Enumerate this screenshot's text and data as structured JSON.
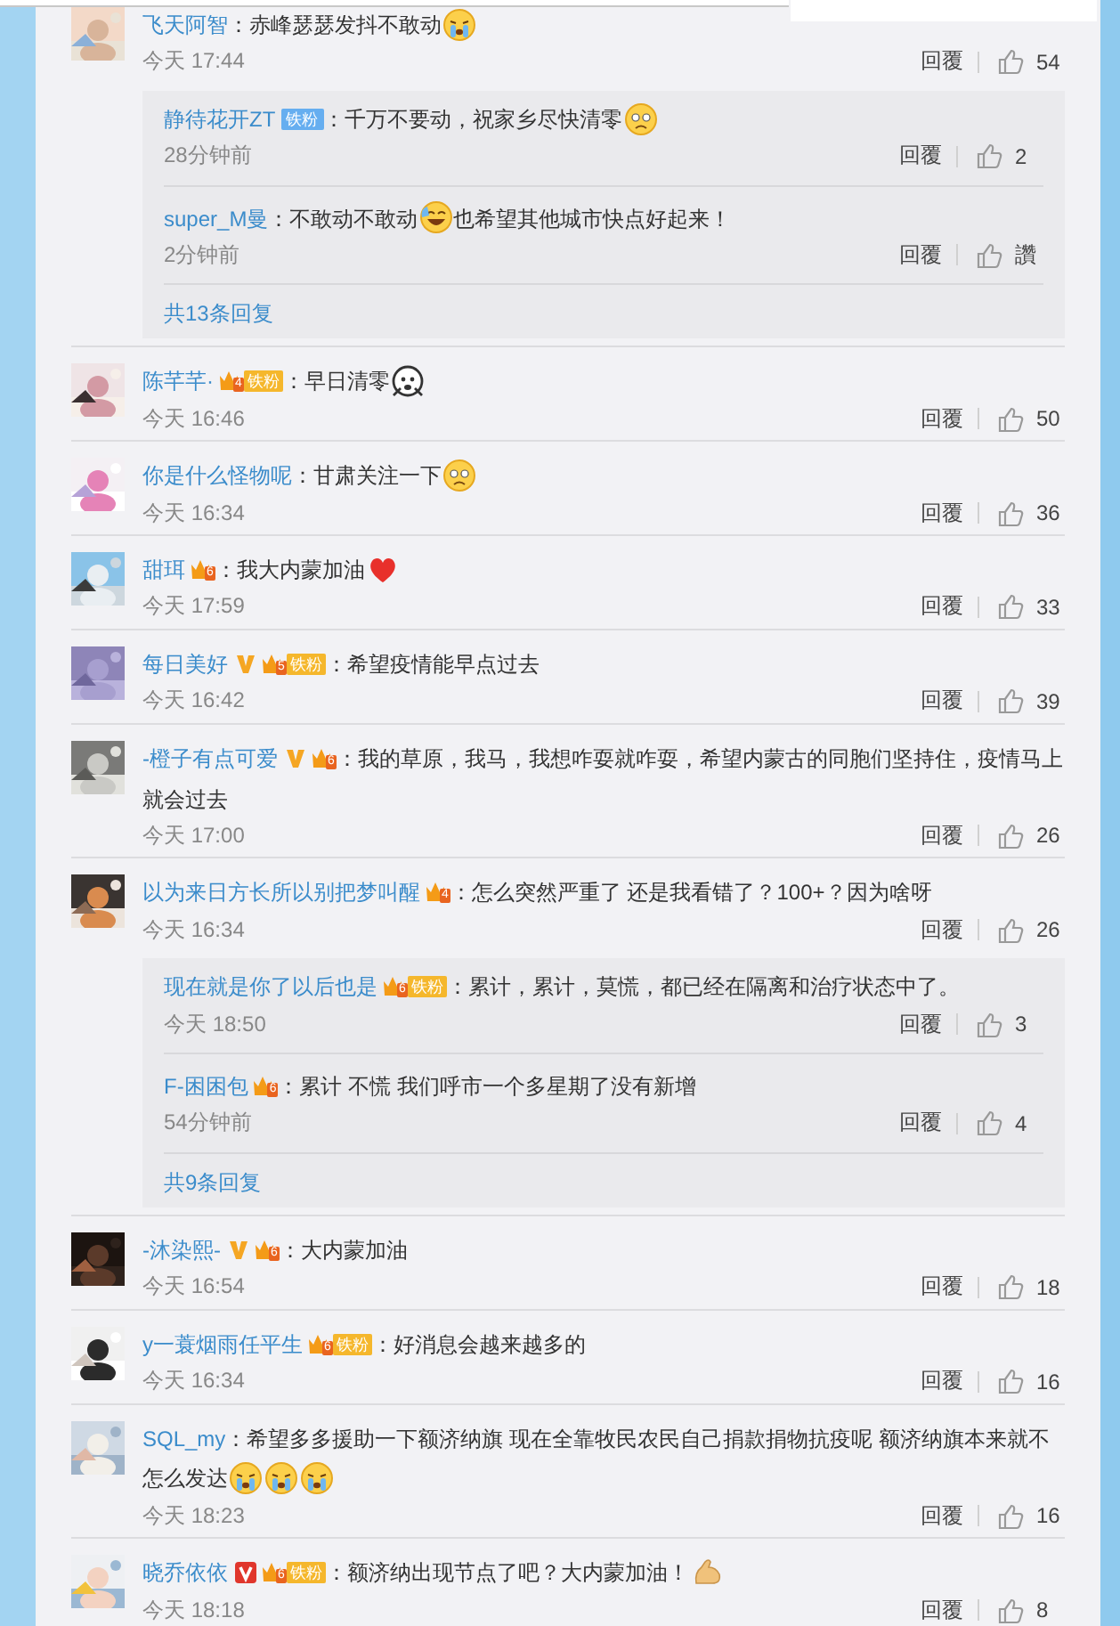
{
  "comments": [
    {
      "name": "飞天阿智",
      "lines": [
        [
          {
            "kind": "text",
            "text": "：赤峰瑟瑟发抖不敢动"
          },
          {
            "kind": "crying"
          }
        ]
      ],
      "time": "今天 17:44",
      "reply_label": "回覆",
      "likes": "54",
      "replies": [
        {
          "name": "静待花开ZT",
          "badges": [
            {
              "kind": "fan-blue",
              "text": "铁粉"
            }
          ],
          "lines": [
            [
              {
                "kind": "text",
                "text": "：千万不要动，祝家乡尽快清零"
              },
              {
                "kind": "sad"
              }
            ]
          ],
          "time": "28分钟前",
          "reply_label": "回覆",
          "likes": "2"
        },
        {
          "name": "super_M曼",
          "lines": [
            [
              {
                "kind": "text",
                "text": "：不敢动不敢动"
              },
              {
                "kind": "laughing"
              },
              {
                "kind": "text",
                "text": "也希望其他城市快点好起来！"
              }
            ]
          ],
          "time": "2分钟前",
          "reply_label": "回覆",
          "likes": "讚"
        }
      ],
      "more": "共13条回复"
    },
    {
      "name": "陈芊芊·",
      "badges": [
        {
          "kind": "crown",
          "text": "4"
        },
        {
          "kind": "fan",
          "text": "铁粉"
        }
      ],
      "lines": [
        [
          {
            "kind": "text",
            "text": "：早日清零"
          },
          {
            "kind": "scared"
          }
        ]
      ],
      "time": "今天 16:46",
      "reply_label": "回覆",
      "likes": "50"
    },
    {
      "name": "你是什么怪物呢",
      "lines": [
        [
          {
            "kind": "text",
            "text": "：甘肃关注一下"
          },
          {
            "kind": "sad"
          }
        ]
      ],
      "time": "今天 16:34",
      "reply_label": "回覆",
      "likes": "36"
    },
    {
      "name": "甜珥",
      "badges": [
        {
          "kind": "crown",
          "text": "6"
        }
      ],
      "lines": [
        [
          {
            "kind": "text",
            "text": "：我大内蒙加油"
          },
          {
            "kind": "heart"
          }
        ]
      ],
      "time": "今天 17:59",
      "reply_label": "回覆",
      "likes": "33"
    },
    {
      "name": "每日美好",
      "badges": [
        {
          "kind": "verified",
          "color": "#f5a623"
        },
        {
          "kind": "crown",
          "text": "5"
        },
        {
          "kind": "fan",
          "text": "铁粉"
        }
      ],
      "lines": [
        [
          {
            "kind": "text",
            "text": "：希望疫情能早点过去"
          }
        ]
      ],
      "time": "今天 16:42",
      "reply_label": "回覆",
      "likes": "39"
    },
    {
      "name": "-橙子有点可爱",
      "badges": [
        {
          "kind": "verified",
          "color": "#f5a623"
        },
        {
          "kind": "crown",
          "text": "6"
        }
      ],
      "lines": [
        [
          {
            "kind": "text",
            "text": "：我的草原，我马，我想咋耍就咋耍，希望内蒙古的同胞们坚持住，疫情马上"
          }
        ],
        [
          {
            "kind": "text",
            "text": "就会过去"
          }
        ]
      ],
      "time": "今天 17:00",
      "reply_label": "回覆",
      "likes": "26"
    },
    {
      "name": "以为来日方长所以别把梦叫醒",
      "badges": [
        {
          "kind": "crown",
          "text": "4"
        }
      ],
      "lines": [
        [
          {
            "kind": "text",
            "text": "：怎么突然严重了 还是我看错了？100+？因为啥呀"
          }
        ]
      ],
      "time": "今天 16:34",
      "reply_label": "回覆",
      "likes": "26",
      "replies": [
        {
          "name": "现在就是你了以后也是",
          "badges": [
            {
              "kind": "crown",
              "text": "6"
            },
            {
              "kind": "fan",
              "text": "铁粉"
            }
          ],
          "lines": [
            [
              {
                "kind": "text",
                "text": "：累计，累计，莫慌，都已经在隔离和治疗状态中了。"
              }
            ]
          ],
          "time": "今天 18:50",
          "reply_label": "回覆",
          "likes": "3"
        },
        {
          "name": "F-困困包",
          "badges": [
            {
              "kind": "crown",
              "text": "6"
            }
          ],
          "lines": [
            [
              {
                "kind": "text",
                "text": "：累计 不慌 我们呼市一个多星期了没有新增"
              }
            ]
          ],
          "time": "54分钟前",
          "reply_label": "回覆",
          "likes": "4"
        }
      ],
      "more": "共9条回复"
    },
    {
      "name": "-沐染熙-",
      "badges": [
        {
          "kind": "verified",
          "color": "#f5a623"
        },
        {
          "kind": "crown",
          "text": "6"
        }
      ],
      "lines": [
        [
          {
            "kind": "text",
            "text": "：大内蒙加油"
          }
        ]
      ],
      "time": "今天 16:54",
      "reply_label": "回覆",
      "likes": "18"
    },
    {
      "name": "y一蓑烟雨任平生",
      "badges": [
        {
          "kind": "crown",
          "text": "6"
        },
        {
          "kind": "fan",
          "text": "铁粉"
        }
      ],
      "lines": [
        [
          {
            "kind": "text",
            "text": "：好消息会越来越多的"
          }
        ]
      ],
      "time": "今天 16:34",
      "reply_label": "回覆",
      "likes": "16"
    },
    {
      "name": "SQL_my",
      "lines": [
        [
          {
            "kind": "text",
            "text": "：希望多多援助一下额济纳旗  现在全靠牧民农民自己捐款捐物抗疫呢 额济纳旗本来就不"
          }
        ],
        [
          {
            "kind": "text",
            "text": "怎么发达"
          },
          {
            "kind": "crying"
          },
          {
            "kind": "crying"
          },
          {
            "kind": "crying"
          }
        ]
      ],
      "time": "今天 18:23",
      "reply_label": "回覆",
      "likes": "16"
    },
    {
      "name": "晓乔依依",
      "badges": [
        {
          "kind": "verified",
          "color": "#e0362c"
        },
        {
          "kind": "crown",
          "text": "6"
        },
        {
          "kind": "fan",
          "text": "铁粉"
        }
      ],
      "lines": [
        [
          {
            "kind": "text",
            "text": "：额济纳出现节点了吧？大内蒙加油！"
          },
          {
            "kind": "muscle"
          }
        ]
      ],
      "time": "今天 18:18",
      "reply_label": "回覆",
      "likes": "8"
    }
  ]
}
